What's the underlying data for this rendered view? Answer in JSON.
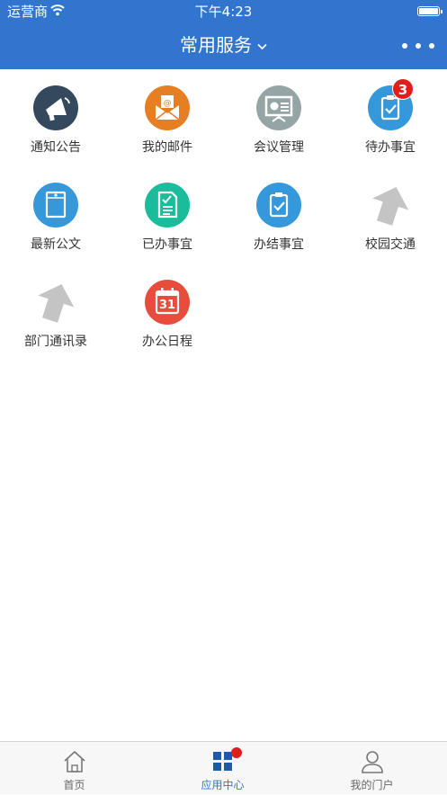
{
  "status_bar": {
    "carrier": "运营商",
    "time": "下午4:23"
  },
  "nav": {
    "title": "常用服务"
  },
  "colors": {
    "primary": "#3175cf",
    "badge": "#e21d1d"
  },
  "services": [
    {
      "label": "通知公告",
      "icon": "megaphone-icon",
      "color": "#34485e"
    },
    {
      "label": "我的邮件",
      "icon": "mail-icon",
      "color": "#e67f22"
    },
    {
      "label": "会议管理",
      "icon": "presentation-board-icon",
      "color": "#95a5a6"
    },
    {
      "label": "待办事宜",
      "icon": "clipboard-check-icon",
      "color": "#3598db",
      "badge": "3"
    },
    {
      "label": "最新公文",
      "icon": "document-envelope-icon",
      "color": "#3598db"
    },
    {
      "label": "已办事宜",
      "icon": "document-check-icon",
      "color": "#1bbc9b"
    },
    {
      "label": "办结事宜",
      "icon": "clipboard-check-icon",
      "color": "#3598db"
    },
    {
      "label": "校园交通",
      "icon": "placeholder-arrow-icon"
    },
    {
      "label": "部门通讯录",
      "icon": "placeholder-arrow-icon"
    },
    {
      "label": "办公日程",
      "icon": "calendar-icon",
      "color": "#e74c3c",
      "icon_text": "31"
    }
  ],
  "tabbar": {
    "items": [
      {
        "label": "首页",
        "icon": "home-icon"
      },
      {
        "label": "应用中心",
        "icon": "grid-apps-icon",
        "active": true
      },
      {
        "label": "我的门户",
        "icon": "user-icon"
      }
    ]
  }
}
